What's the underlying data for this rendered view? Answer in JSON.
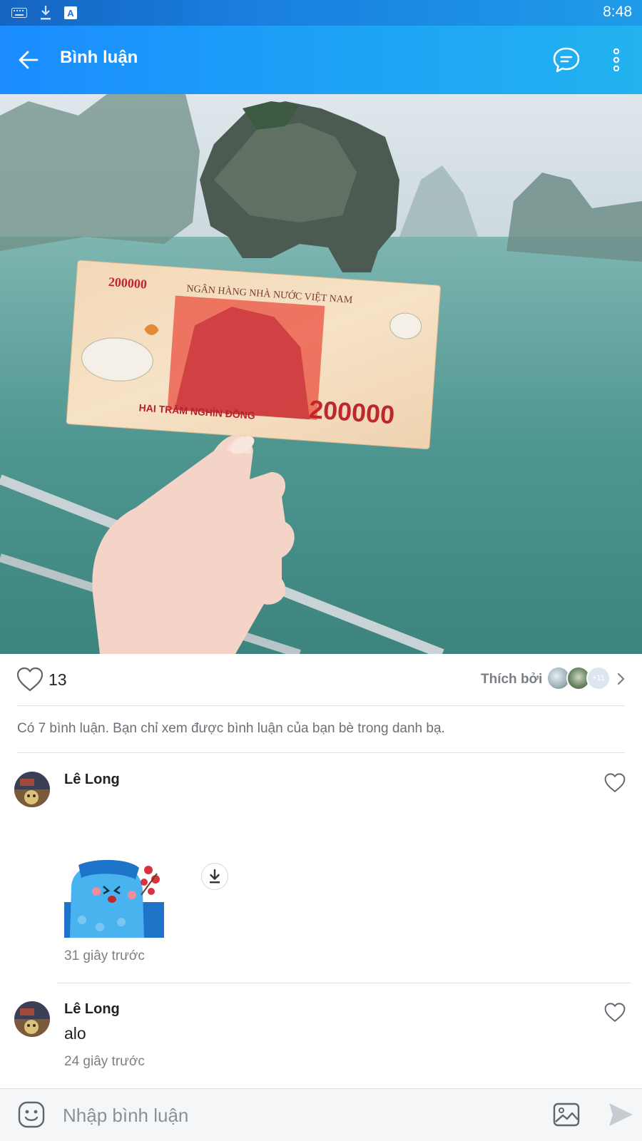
{
  "status_bar": {
    "time": "8:48",
    "icons": [
      "keyboard-icon",
      "download-icon",
      "translate-icon"
    ]
  },
  "app_bar": {
    "title": "Bình luận",
    "icons": [
      "back-arrow-icon",
      "chat-bubble-icon",
      "more-vert-icon"
    ]
  },
  "photo": {
    "banknote_top_value": "200000",
    "banknote_bottom_value": "200000",
    "banknote_bank": "NGÂN HÀNG NHÀ NƯỚC VIỆT NAM",
    "banknote_words": "HAI TRĂM NGHÌN ĐỒNG"
  },
  "likes": {
    "count": "13",
    "liked_by_label": "Thích bởi",
    "more_count": "+11"
  },
  "notice": "Có 7 bình luận. Bạn chỉ xem được bình luận của bạn bè trong danh bạ.",
  "comments": [
    {
      "author": "Lê Long",
      "text": "",
      "has_sticker": true,
      "time": "31 giây trước"
    },
    {
      "author": "Lê Long",
      "text": "alo",
      "has_sticker": false,
      "time": "24 giây trước"
    }
  ],
  "input": {
    "placeholder": "Nhập bình luận"
  },
  "colors": {
    "app_bar_start": "#1a8cff",
    "app_bar_end": "#21b2ef",
    "status_bar": "#1565c0",
    "muted_text": "#7a7f86"
  }
}
